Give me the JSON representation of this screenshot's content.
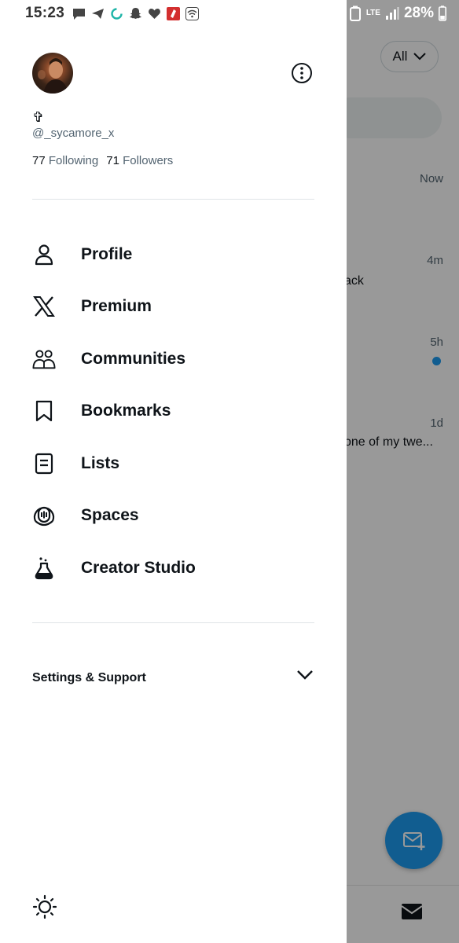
{
  "status_bar": {
    "time": "15:23",
    "battery": "28%",
    "network": "LTE"
  },
  "background": {
    "filter_label": "All",
    "items": [
      {
        "time": "Now",
        "snippet": ""
      },
      {
        "time": "4m",
        "snippet": "ack"
      },
      {
        "time": "5h",
        "snippet": "",
        "unread": true
      },
      {
        "time": "1d",
        "snippet": "one of my twe..."
      }
    ]
  },
  "profile": {
    "display_name": "✞",
    "handle": "@_sycamore_x",
    "following_count": "77",
    "following_label": "Following",
    "followers_count": "71",
    "followers_label": "Followers"
  },
  "menu": [
    {
      "label": "Profile",
      "icon": "person-icon"
    },
    {
      "label": "Premium",
      "icon": "x-logo-icon"
    },
    {
      "label": "Communities",
      "icon": "communities-icon"
    },
    {
      "label": "Bookmarks",
      "icon": "bookmark-icon"
    },
    {
      "label": "Lists",
      "icon": "list-icon"
    },
    {
      "label": "Spaces",
      "icon": "spaces-icon"
    },
    {
      "label": "Creator Studio",
      "icon": "flask-icon"
    }
  ],
  "settings": {
    "label": "Settings & Support"
  },
  "colors": {
    "accent": "#1d9bf0",
    "text": "#0f1419",
    "secondary_text": "#536471"
  }
}
